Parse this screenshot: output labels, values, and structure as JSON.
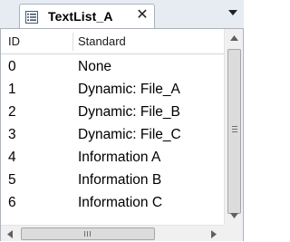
{
  "tab": {
    "title": "TextList_A",
    "icon": "text-list-icon",
    "close_glyph": "✕",
    "menu_icon": "dropdown-arrow-icon"
  },
  "table": {
    "columns": [
      "ID",
      "Standard"
    ],
    "rows": [
      {
        "id": "0",
        "standard": "None"
      },
      {
        "id": "1",
        "standard": "Dynamic: File_A"
      },
      {
        "id": "2",
        "standard": "Dynamic: File_B"
      },
      {
        "id": "3",
        "standard": "Dynamic: File_C"
      },
      {
        "id": "4",
        "standard": "Information A"
      },
      {
        "id": "5",
        "standard": "Information B"
      },
      {
        "id": "6",
        "standard": "Information C"
      }
    ]
  },
  "scrollbars": {
    "vertical": {
      "up_icon": "scroll-up-arrow-icon",
      "down_icon": "scroll-down-arrow-icon"
    },
    "horizontal": {
      "left_icon": "scroll-left-arrow-icon",
      "right_icon": "scroll-right-arrow-icon"
    }
  },
  "colors": {
    "tab_strip": "#e7ecf2",
    "border": "#a9b4c2",
    "background": "#ffffff"
  }
}
